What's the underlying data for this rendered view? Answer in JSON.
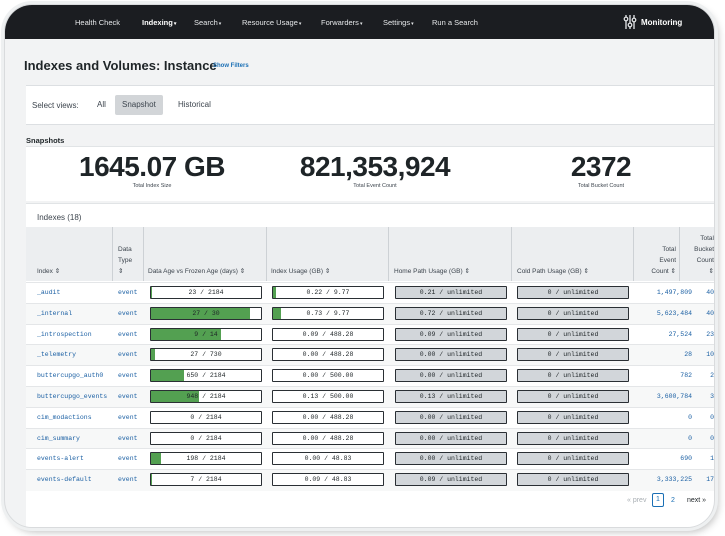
{
  "nav": {
    "items": [
      {
        "label": "Health Check",
        "caret": ""
      },
      {
        "label": "Indexing",
        "caret": "▾"
      },
      {
        "label": "Search",
        "caret": "▾"
      },
      {
        "label": "Resource Usage",
        "caret": "▾"
      },
      {
        "label": "Forwarders",
        "caret": "▾"
      },
      {
        "label": "Settings",
        "caret": "▾"
      },
      {
        "label": "Run a Search",
        "caret": ""
      }
    ],
    "active": "Indexing",
    "app_name": "Monitoring"
  },
  "page": {
    "title": "Indexes and Volumes: Instance",
    "show_filters": "Show Filters"
  },
  "views": {
    "label": "Select views:",
    "options": [
      "All",
      "Snapshot",
      "Historical"
    ],
    "selected": "Snapshot"
  },
  "snapshots": {
    "title": "Snapshots",
    "kpis": [
      {
        "value": "1645.07 GB",
        "label": "Total Index Size"
      },
      {
        "value": "821,353,924",
        "label": "Total Event Count"
      },
      {
        "value": "2372",
        "label": "Total Bucket Count"
      }
    ]
  },
  "indexes": {
    "title": "Indexes (18)",
    "headers": {
      "index": "Index ⇕",
      "data_type_1": "Data",
      "data_type_2": "Type",
      "data_type_3": "⇕",
      "data_age": "Data Age vs Frozen Age (days) ⇕",
      "index_usage": "Index Usage (GB) ⇕",
      "home_path": "Home Path Usage (GB) ⇕",
      "cold_path": "Cold Path Usage (GB) ⇕",
      "event_1": "Total",
      "event_2": "Event",
      "event_3": "Count ⇕",
      "bucket_1": "Total",
      "bucket_2": "Bucket",
      "bucket_3": "Count",
      "bucket_4": "⇕"
    },
    "rows": [
      {
        "name": "_audit",
        "type": "event",
        "age": "23 / 2184",
        "age_frac": 0.011,
        "usage": "0.22 / 9.77",
        "usage_frac": 0.023,
        "home": "0.21 / unlimited",
        "cold": "0 / unlimited",
        "events": "1,497,809",
        "buckets": "40"
      },
      {
        "name": "_internal",
        "type": "event",
        "age": "27 / 30",
        "age_frac": 0.9,
        "usage": "0.73 / 9.77",
        "usage_frac": 0.075,
        "home": "0.72 / unlimited",
        "cold": "0 / unlimited",
        "events": "5,623,484",
        "buckets": "40"
      },
      {
        "name": "_introspection",
        "type": "event",
        "age": "9 / 14",
        "age_frac": 0.64,
        "usage": "0.09 / 488.28",
        "usage_frac": 0.0,
        "home": "0.09 / unlimited",
        "cold": "0 / unlimited",
        "events": "27,524",
        "buckets": "23"
      },
      {
        "name": "_telemetry",
        "type": "event",
        "age": "27 / 730",
        "age_frac": 0.037,
        "usage": "0.00 / 488.28",
        "usage_frac": 0.0,
        "home": "0.00 / unlimited",
        "cold": "0 / unlimited",
        "events": "28",
        "buckets": "10"
      },
      {
        "name": "buttercupgo_auth0",
        "type": "event",
        "age": "650 / 2184",
        "age_frac": 0.298,
        "usage": "0.00 / 500.00",
        "usage_frac": 0.0,
        "home": "0.00 / unlimited",
        "cold": "0 / unlimited",
        "events": "782",
        "buckets": "2"
      },
      {
        "name": "buttercupgo_events",
        "type": "event",
        "age": "948 / 2184",
        "age_frac": 0.434,
        "usage": "0.13 / 500.00",
        "usage_frac": 0.0,
        "home": "0.13 / unlimited",
        "cold": "0 / unlimited",
        "events": "3,600,784",
        "buckets": "3"
      },
      {
        "name": "cim_modactions",
        "type": "event",
        "age": "0 / 2184",
        "age_frac": 0.0,
        "usage": "0.00 / 488.28",
        "usage_frac": 0.0,
        "home": "0.00 / unlimited",
        "cold": "0 / unlimited",
        "events": "0",
        "buckets": "0"
      },
      {
        "name": "cim_summary",
        "type": "event",
        "age": "0 / 2184",
        "age_frac": 0.0,
        "usage": "0.00 / 488.28",
        "usage_frac": 0.0,
        "home": "0.00 / unlimited",
        "cold": "0 / unlimited",
        "events": "0",
        "buckets": "0"
      },
      {
        "name": "events-alert",
        "type": "event",
        "age": "198 / 2184",
        "age_frac": 0.091,
        "usage": "0.00 / 48.83",
        "usage_frac": 0.0,
        "home": "0.00 / unlimited",
        "cold": "0 / unlimited",
        "events": "690",
        "buckets": "1"
      },
      {
        "name": "events-default",
        "type": "event",
        "age": "7 / 2184",
        "age_frac": 0.003,
        "usage": "0.09 / 48.83",
        "usage_frac": 0.0,
        "home": "0.09 / unlimited",
        "cold": "0 / unlimited",
        "events": "3,333,225",
        "buckets": "17"
      }
    ]
  },
  "pagination": {
    "prev": "« prev",
    "pages": [
      "1",
      "2"
    ],
    "current": "1",
    "next": "next »"
  },
  "colors": {
    "nav_bg": "#1b1d21",
    "bar_fill": "#53a051",
    "link": "#1a5fa3",
    "header_bg": "#eceef0"
  }
}
